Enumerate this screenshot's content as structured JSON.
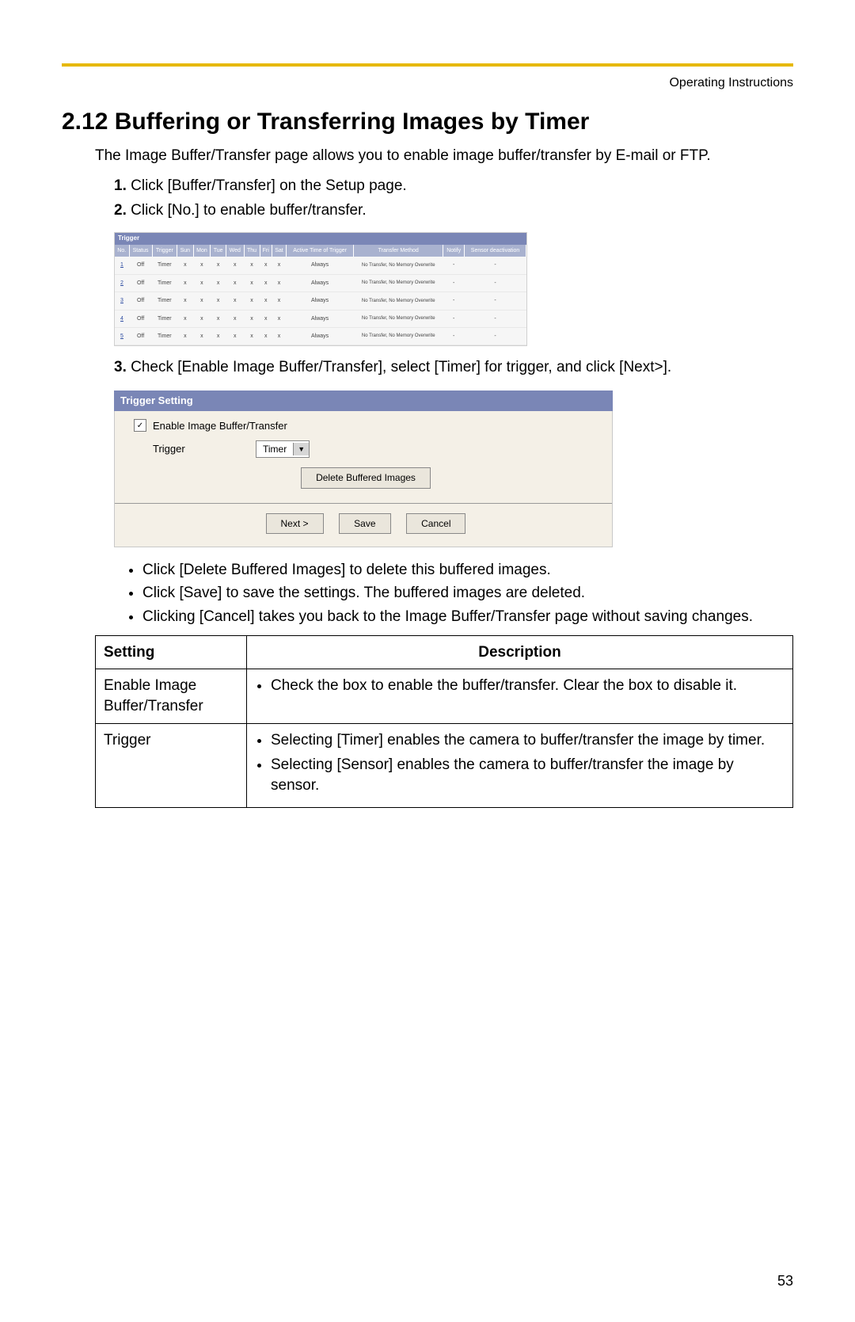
{
  "header": {
    "doc_title": "Operating Instructions"
  },
  "title": "2.12  Buffering or Transferring Images by Timer",
  "intro": "The Image Buffer/Transfer page allows you to enable image buffer/transfer by E-mail or FTP.",
  "steps": [
    {
      "n": "1.",
      "text": "Click [Buffer/Transfer] on the Setup page."
    },
    {
      "n": "2.",
      "text": "Click [No.] to enable buffer/transfer."
    },
    {
      "n": "3.",
      "text": "Check [Enable Image Buffer/Transfer], select [Timer] for trigger, and click [Next>]."
    }
  ],
  "trigger_table": {
    "caption": "Trigger",
    "headers": [
      "No.",
      "Status",
      "Trigger",
      "Sun",
      "Mon",
      "Tue",
      "Wed",
      "Thu",
      "Fri",
      "Sat",
      "Active Time of Trigger",
      "Transfer Method",
      "Notify",
      "Sensor deactivation"
    ],
    "transfer_method_text": "No Transfer, No Memory Overwrite",
    "rows": [
      {
        "no": "1",
        "status": "Off",
        "trigger": "Timer",
        "days": [
          "x",
          "x",
          "x",
          "x",
          "x",
          "x",
          "x"
        ],
        "active": "Always",
        "notify": "-",
        "sensor": "-"
      },
      {
        "no": "2",
        "status": "Off",
        "trigger": "Timer",
        "days": [
          "x",
          "x",
          "x",
          "x",
          "x",
          "x",
          "x"
        ],
        "active": "Always",
        "notify": "-",
        "sensor": "-"
      },
      {
        "no": "3",
        "status": "Off",
        "trigger": "Timer",
        "days": [
          "x",
          "x",
          "x",
          "x",
          "x",
          "x",
          "x"
        ],
        "active": "Always",
        "notify": "-",
        "sensor": "-"
      },
      {
        "no": "4",
        "status": "Off",
        "trigger": "Timer",
        "days": [
          "x",
          "x",
          "x",
          "x",
          "x",
          "x",
          "x"
        ],
        "active": "Always",
        "notify": "-",
        "sensor": "-"
      },
      {
        "no": "5",
        "status": "Off",
        "trigger": "Timer",
        "days": [
          "x",
          "x",
          "x",
          "x",
          "x",
          "x",
          "x"
        ],
        "active": "Always",
        "notify": "-",
        "sensor": "-"
      }
    ]
  },
  "trigger_setting": {
    "title": "Trigger Setting",
    "enable_label": "Enable Image Buffer/Transfer",
    "trigger_label": "Trigger",
    "trigger_value": "Timer",
    "delete_btn": "Delete Buffered Images",
    "next_btn": "Next >",
    "save_btn": "Save",
    "cancel_btn": "Cancel"
  },
  "bullets": [
    "Click [Delete Buffered Images] to delete this buffered images.",
    "Click [Save] to save the settings. The buffered images are deleted.",
    "Clicking [Cancel] takes you back to the Image Buffer/Transfer page without saving changes."
  ],
  "setting_table": {
    "head_setting": "Setting",
    "head_desc": "Description",
    "row1_setting": "Enable Image Buffer/Transfer",
    "row1_desc": "Check the box to enable the buffer/transfer. Clear the box to disable it.",
    "row2_setting": "Trigger",
    "row2_desc_a": "Selecting [Timer] enables the camera to buffer/transfer the image by timer.",
    "row2_desc_b": "Selecting [Sensor] enables the camera to buffer/transfer the image by sensor."
  },
  "page_number": "53"
}
